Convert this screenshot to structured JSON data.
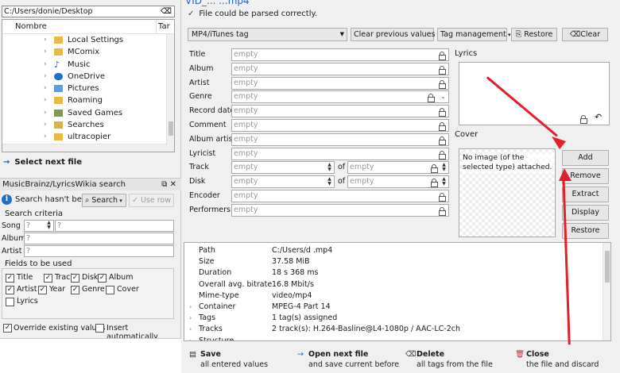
{
  "left": {
    "path": "C:/Users/donie/Desktop",
    "col_name": "Nombre",
    "col_size": "Tar",
    "tree_items": [
      {
        "label": "Local Settings",
        "icon": "folder-icon"
      },
      {
        "label": "MComix",
        "icon": "folder-icon"
      },
      {
        "label": "Music",
        "icon": "music-icon"
      },
      {
        "label": "OneDrive",
        "icon": "cloud-icon"
      },
      {
        "label": "Pictures",
        "icon": "pictures-icon"
      },
      {
        "label": "Roaming",
        "icon": "folder-icon"
      },
      {
        "label": "Saved Games",
        "icon": "saved-games-icon"
      },
      {
        "label": "Searches",
        "icon": "search-folder-icon"
      },
      {
        "label": "ultracopier",
        "icon": "folder-icon"
      }
    ],
    "select_next": "Select next file",
    "mb_title": "MusicBrainz/LyricsWikia search",
    "mb_status": "Search hasn't been",
    "mb_search_btn": "Search",
    "mb_use_row": "Use row",
    "criteria_label": "Search criteria",
    "song_label": "Song",
    "song_value": "?",
    "song_hint": "?",
    "album_label": "Album",
    "album_value": "?",
    "artist_label": "Artist",
    "artist_value": "?",
    "fields_label": "Fields to be used",
    "fields": [
      {
        "label": "Title",
        "checked": true
      },
      {
        "label": "Track",
        "checked": true
      },
      {
        "label": "Disk",
        "checked": true
      },
      {
        "label": "Album",
        "checked": true
      },
      {
        "label": "Artist",
        "checked": true
      },
      {
        "label": "Year",
        "checked": true
      },
      {
        "label": "Genre",
        "checked": true
      },
      {
        "label": "Cover",
        "checked": false
      },
      {
        "label": "Lyrics",
        "checked": false
      }
    ],
    "override_label": "Override existing values",
    "override_checked": true,
    "insert_auto_label": "Insert automatically",
    "insert_auto_checked": false
  },
  "right": {
    "file_title": "VID_...         ...mp4",
    "parsed_msg": "File could be parsed correctly.",
    "tag_type": "MP4/iTunes tag",
    "clear_prev": "Clear previous values",
    "tag_mgmt": "Tag management",
    "restore": "Restore",
    "clear": "Clear",
    "placeholder": "empty",
    "of_label": "of",
    "fields": [
      "Title",
      "Album",
      "Artist",
      "Genre",
      "Record date",
      "Comment",
      "Album artist",
      "Lyricist",
      "Track",
      "Disk",
      "Encoder",
      "Performers"
    ],
    "lyrics_label": "Lyrics",
    "cover_label": "Cover",
    "cover_msg": "No image (of the selected type) attached.",
    "cover_buttons": [
      "Add",
      "Remove",
      "Extract",
      "Display",
      "Restore"
    ],
    "info": [
      {
        "key": "Path",
        "value": "C:/Users/d                                         .mp4",
        "expand": false
      },
      {
        "key": "Size",
        "value": "37.58 MiB",
        "expand": false
      },
      {
        "key": "Duration",
        "value": "18 s 368 ms",
        "expand": false
      },
      {
        "key": "Overall avg. bitrate",
        "value": "16.8 Mbit/s",
        "expand": false
      },
      {
        "key": "Mime-type",
        "value": "video/mp4",
        "expand": false
      },
      {
        "key": "Container",
        "value": "MPEG-4 Part 14",
        "expand": true
      },
      {
        "key": "Tags",
        "value": "1 tag(s) assigned",
        "expand": true
      },
      {
        "key": "Tracks",
        "value": "2 track(s): H.264-Basline@L4-1080p / AAC-LC-2ch",
        "expand": true
      },
      {
        "key": "Structure",
        "value": "",
        "expand": true
      }
    ],
    "actions": [
      {
        "title": "Save",
        "sub": "all entered values",
        "icon": "save-icon"
      },
      {
        "title": "Open next file",
        "sub": "and save current before",
        "icon": "arrow-right-icon"
      },
      {
        "title": "Delete",
        "sub": "all tags from the file",
        "icon": "delete-icon"
      },
      {
        "title": "Close",
        "sub": "the file and discard",
        "icon": "trash-icon"
      }
    ]
  },
  "colors": {
    "annotation_arrow": "#e0202a",
    "link_blue": "#2a62b8"
  }
}
